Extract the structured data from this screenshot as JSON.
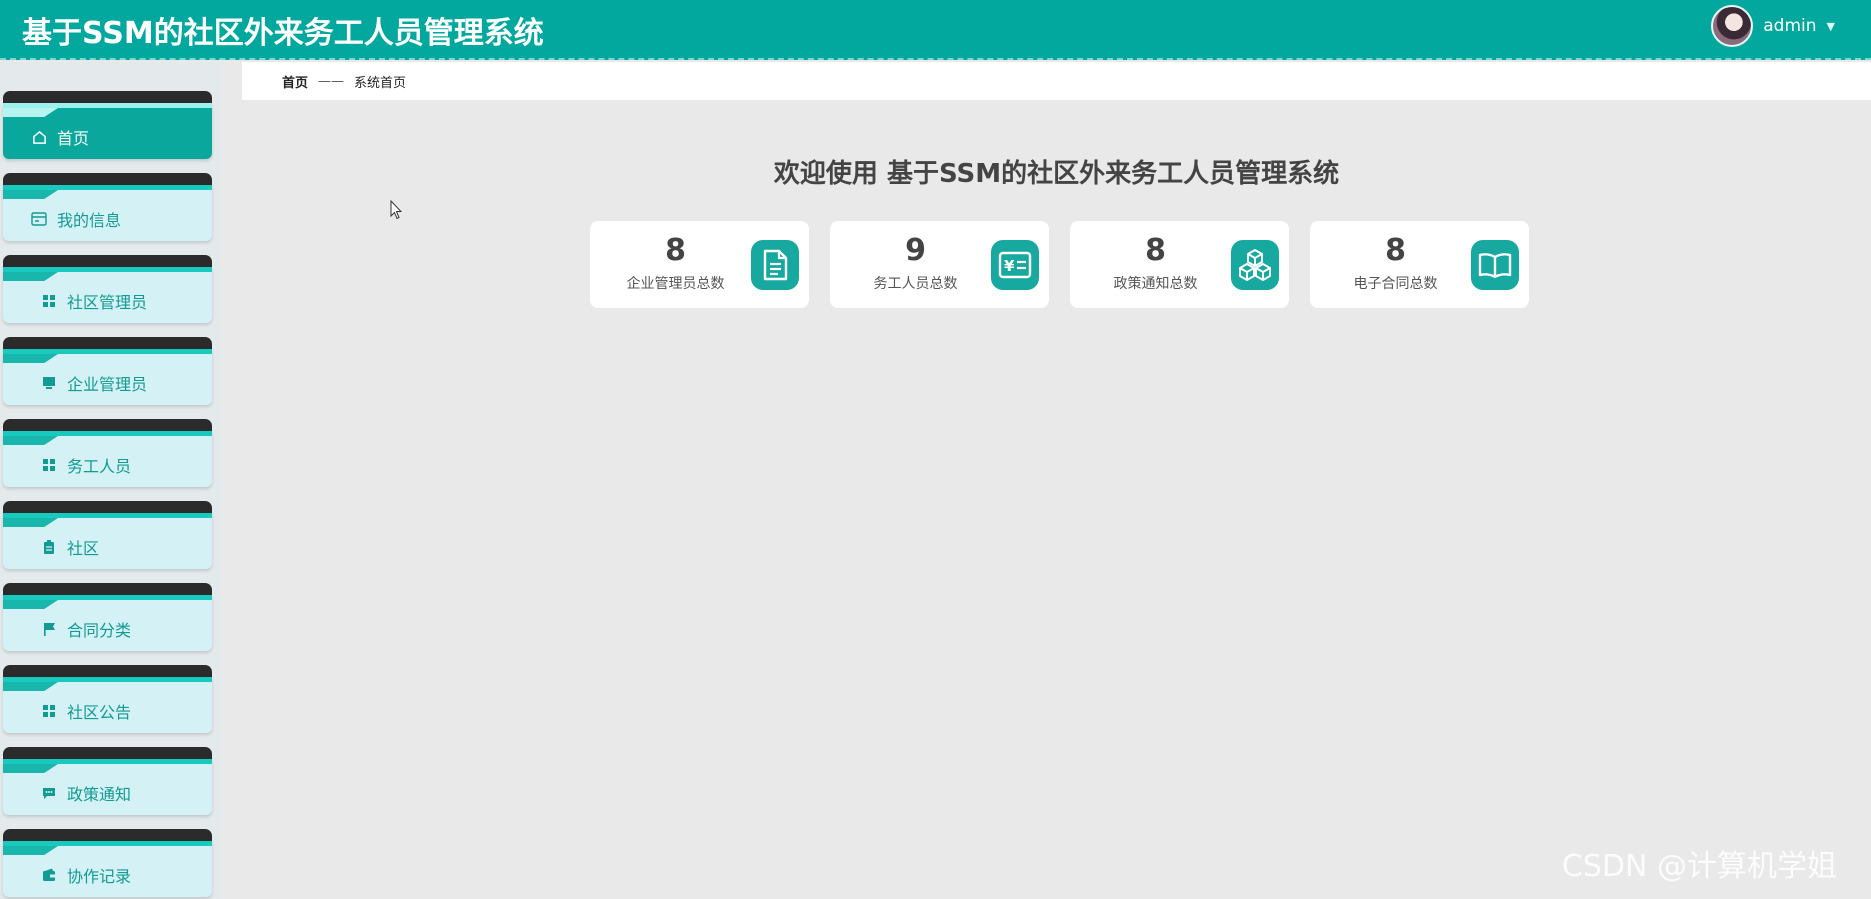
{
  "app": {
    "title": "基于SSM的社区外来务工人员管理系统"
  },
  "user": {
    "name": "admin"
  },
  "sidebar": {
    "items": [
      {
        "label": "首页",
        "icon": "home-icon",
        "active": true
      },
      {
        "label": "我的信息",
        "icon": "id-card-icon",
        "active": false
      },
      {
        "label": "社区管理员",
        "icon": "grid-icon",
        "active": false
      },
      {
        "label": "企业管理员",
        "icon": "monitor-icon",
        "active": false
      },
      {
        "label": "务工人员",
        "icon": "grid-icon",
        "active": false
      },
      {
        "label": "社区",
        "icon": "clipboard-icon",
        "active": false
      },
      {
        "label": "合同分类",
        "icon": "flag-icon",
        "active": false
      },
      {
        "label": "社区公告",
        "icon": "grid-icon",
        "active": false
      },
      {
        "label": "政策通知",
        "icon": "chat-icon",
        "active": false
      },
      {
        "label": "协作记录",
        "icon": "wallet-icon",
        "active": false
      }
    ]
  },
  "breadcrumb": {
    "home": "首页",
    "separator": "——",
    "current": "系统首页"
  },
  "main": {
    "welcome": "欢迎使用 基于SSM的社区外来务工人员管理系统",
    "cards": [
      {
        "value": "8",
        "label": "企业管理员总数",
        "icon": "document-icon"
      },
      {
        "value": "9",
        "label": "务工人员总数",
        "icon": "yen-card-icon"
      },
      {
        "value": "8",
        "label": "政策通知总数",
        "icon": "cubes-icon"
      },
      {
        "value": "8",
        "label": "电子合同总数",
        "icon": "book-icon"
      }
    ]
  },
  "watermark": "CSDN @计算机学姐",
  "colors": {
    "primary": "#02a89e",
    "sidebar_item": "#d4f1f5",
    "card_icon": "#17a89f"
  }
}
